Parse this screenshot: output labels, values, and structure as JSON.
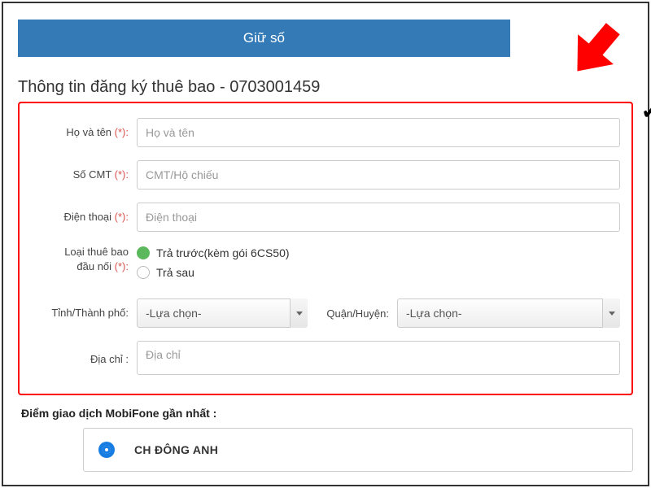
{
  "tab": {
    "label": "Giữ số"
  },
  "section": {
    "title_prefix": "Thông tin đăng ký thuê bao - ",
    "phone_number": "0703001459"
  },
  "form": {
    "fullname": {
      "label": "Họ và tên ",
      "req": "(*):",
      "placeholder": "Họ và tên"
    },
    "idnum": {
      "label": "Số CMT ",
      "req": "(*):",
      "placeholder": "CMT/Hộ chiếu"
    },
    "phone": {
      "label": "Điện thoại ",
      "req": "(*):",
      "placeholder": "Điện thoại"
    },
    "sub_type": {
      "label_line1": "Loại thuê bao",
      "label_line2": "đầu nối ",
      "req": "(*):",
      "opt_prepaid": "Trả trước(kèm gói 6CS50)",
      "opt_postpaid": "Trả sau"
    },
    "province": {
      "label": "Tỉnh/Thành phố:",
      "selected": "-Lựa chọn-"
    },
    "district": {
      "label": "Quận/Huyện:",
      "selected": "-Lựa chọn-"
    },
    "address": {
      "label": "Địa chỉ :",
      "placeholder": "Địa chỉ"
    }
  },
  "nearest": {
    "label": "Điểm giao dịch MobiFone gần nhất :",
    "store_name": "CH ĐÔNG ANH"
  }
}
